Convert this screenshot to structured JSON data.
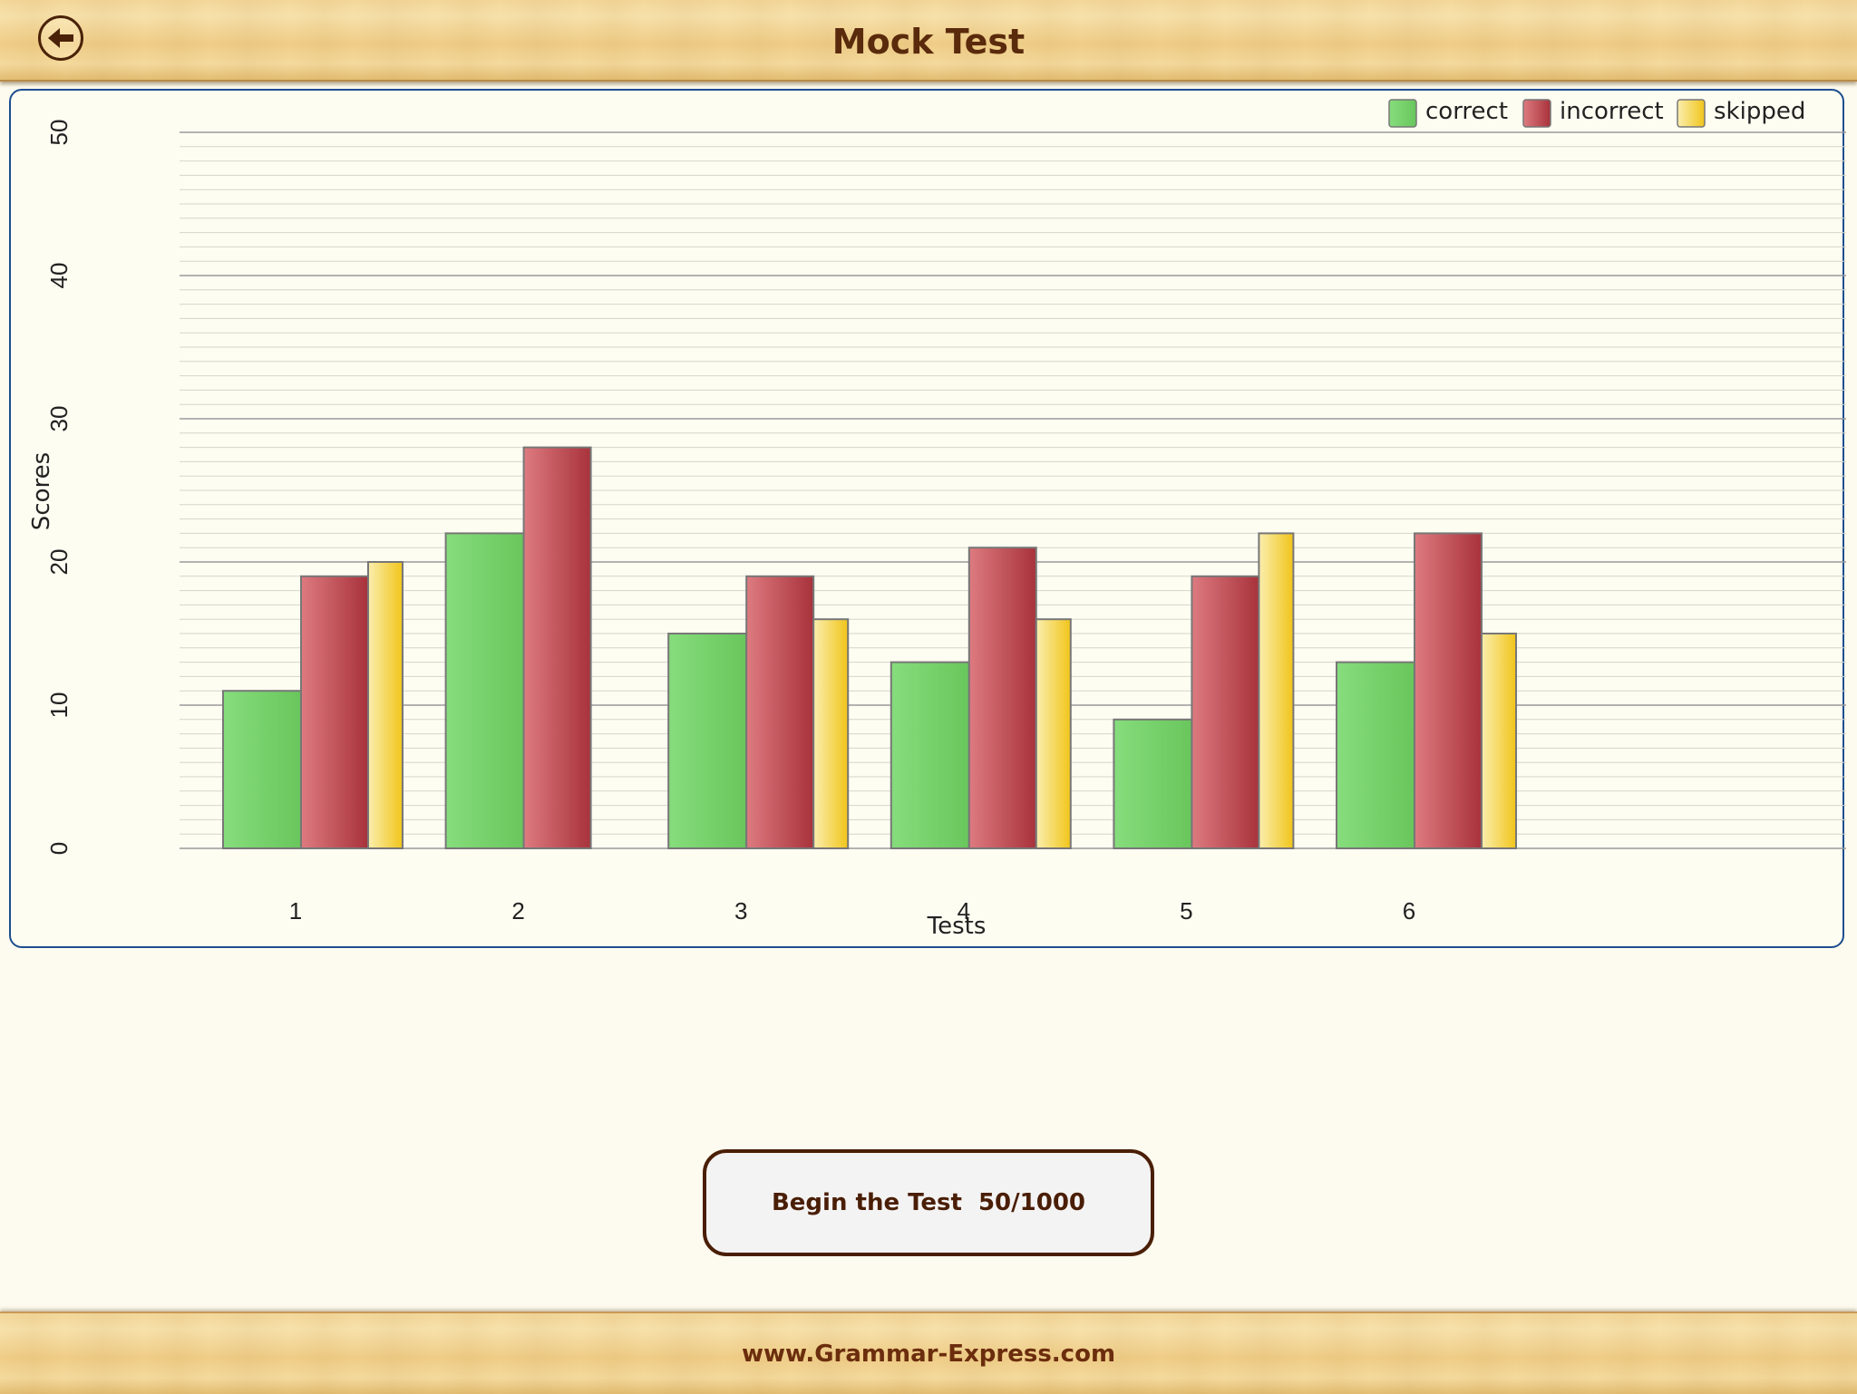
{
  "header": {
    "title": "Mock Test",
    "back_icon": "back-arrow-icon"
  },
  "footer": {
    "website": "www.Grammar-Express.com"
  },
  "begin_button": {
    "label": "Begin the Test",
    "progress": "50/1000"
  },
  "colors": {
    "correct": "#6fd064",
    "incorrect": "#c44b52",
    "skipped": "#f3cd2a",
    "panel_border": "#1d4e8f",
    "title_text": "#5a2a0c"
  },
  "chart_data": {
    "type": "bar",
    "xlabel": "Tests",
    "ylabel": "Scores",
    "ylim": [
      0,
      50
    ],
    "yticks": [
      0,
      10,
      20,
      30,
      40,
      50
    ],
    "grid": true,
    "legend_position": "top-right",
    "categories": [
      "1",
      "2",
      "3",
      "4",
      "5",
      "6"
    ],
    "series": [
      {
        "name": "correct",
        "values": [
          11,
          22,
          15,
          13,
          9,
          13
        ]
      },
      {
        "name": "incorrect",
        "values": [
          19,
          28,
          19,
          21,
          19,
          22
        ]
      },
      {
        "name": "skipped",
        "values": [
          20,
          0,
          16,
          16,
          22,
          15
        ]
      }
    ]
  }
}
